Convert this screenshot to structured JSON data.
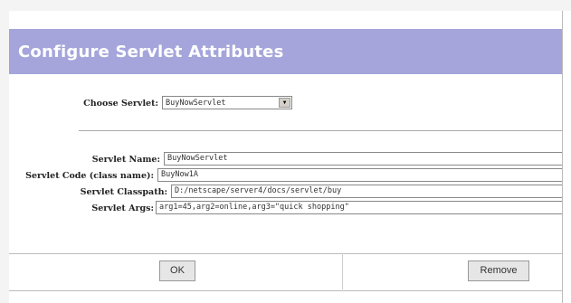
{
  "header": {
    "title": "Configure Servlet Attributes"
  },
  "choose_servlet": {
    "label": "Choose Servlet:",
    "selected": "BuyNowServlet"
  },
  "fields": {
    "servlet_name": {
      "label": "Servlet Name:",
      "value": "BuyNowServlet"
    },
    "servlet_code": {
      "label": "Servlet Code (class name):",
      "value": "BuyNow1A"
    },
    "servlet_classpath": {
      "label": "Servlet Classpath:",
      "value": "D:/netscape/server4/docs/servlet/buy"
    },
    "servlet_args": {
      "label": "Servlet Args:",
      "value": "arg1=45,arg2=online,arg3=\"quick shopping\""
    }
  },
  "buttons": {
    "ok": "OK",
    "remove": "Remove"
  }
}
